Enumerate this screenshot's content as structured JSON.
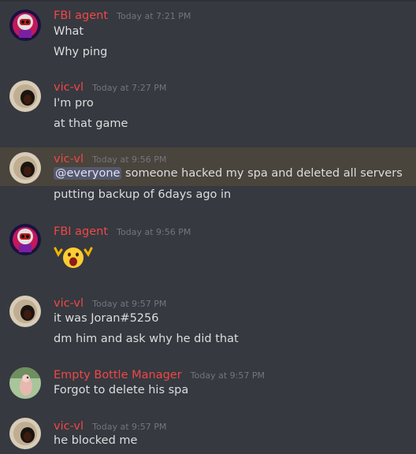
{
  "colors": {
    "background": "#36393f",
    "author_red": "#f04747",
    "timestamp": "#72767d",
    "text": "#dcddde",
    "highlight": "#49443c",
    "mention_bg": "#4a4f86"
  },
  "messages": [
    {
      "author": "FBI agent",
      "timestamp": "Today at 7:21 PM",
      "lines": [
        "What",
        "Why ping"
      ]
    },
    {
      "author": "vic-vl",
      "timestamp": "Today at 7:27 PM",
      "lines": [
        "I'm pro",
        "at that game"
      ]
    },
    {
      "author": "vic-vl",
      "timestamp": "Today at 9:56 PM",
      "mention": "@everyone",
      "lines": [
        " someone hacked my spa and deleted all servers",
        "putting backup of 6days ago in"
      ]
    },
    {
      "author": "FBI agent",
      "timestamp": "Today at 9:56 PM",
      "emoji": "scared-face-emoji"
    },
    {
      "author": "vic-vl",
      "timestamp": "Today at 9:57 PM",
      "lines": [
        "it was Joran#5256",
        "dm him and ask why he did that"
      ]
    },
    {
      "author": "Empty Bottle Manager",
      "timestamp": "Today at 9:57 PM",
      "lines": [
        "Forgot to delete his spa"
      ]
    },
    {
      "author": "vic-vl",
      "timestamp": "Today at 9:57 PM",
      "lines": [
        "he blocked me"
      ]
    }
  ]
}
